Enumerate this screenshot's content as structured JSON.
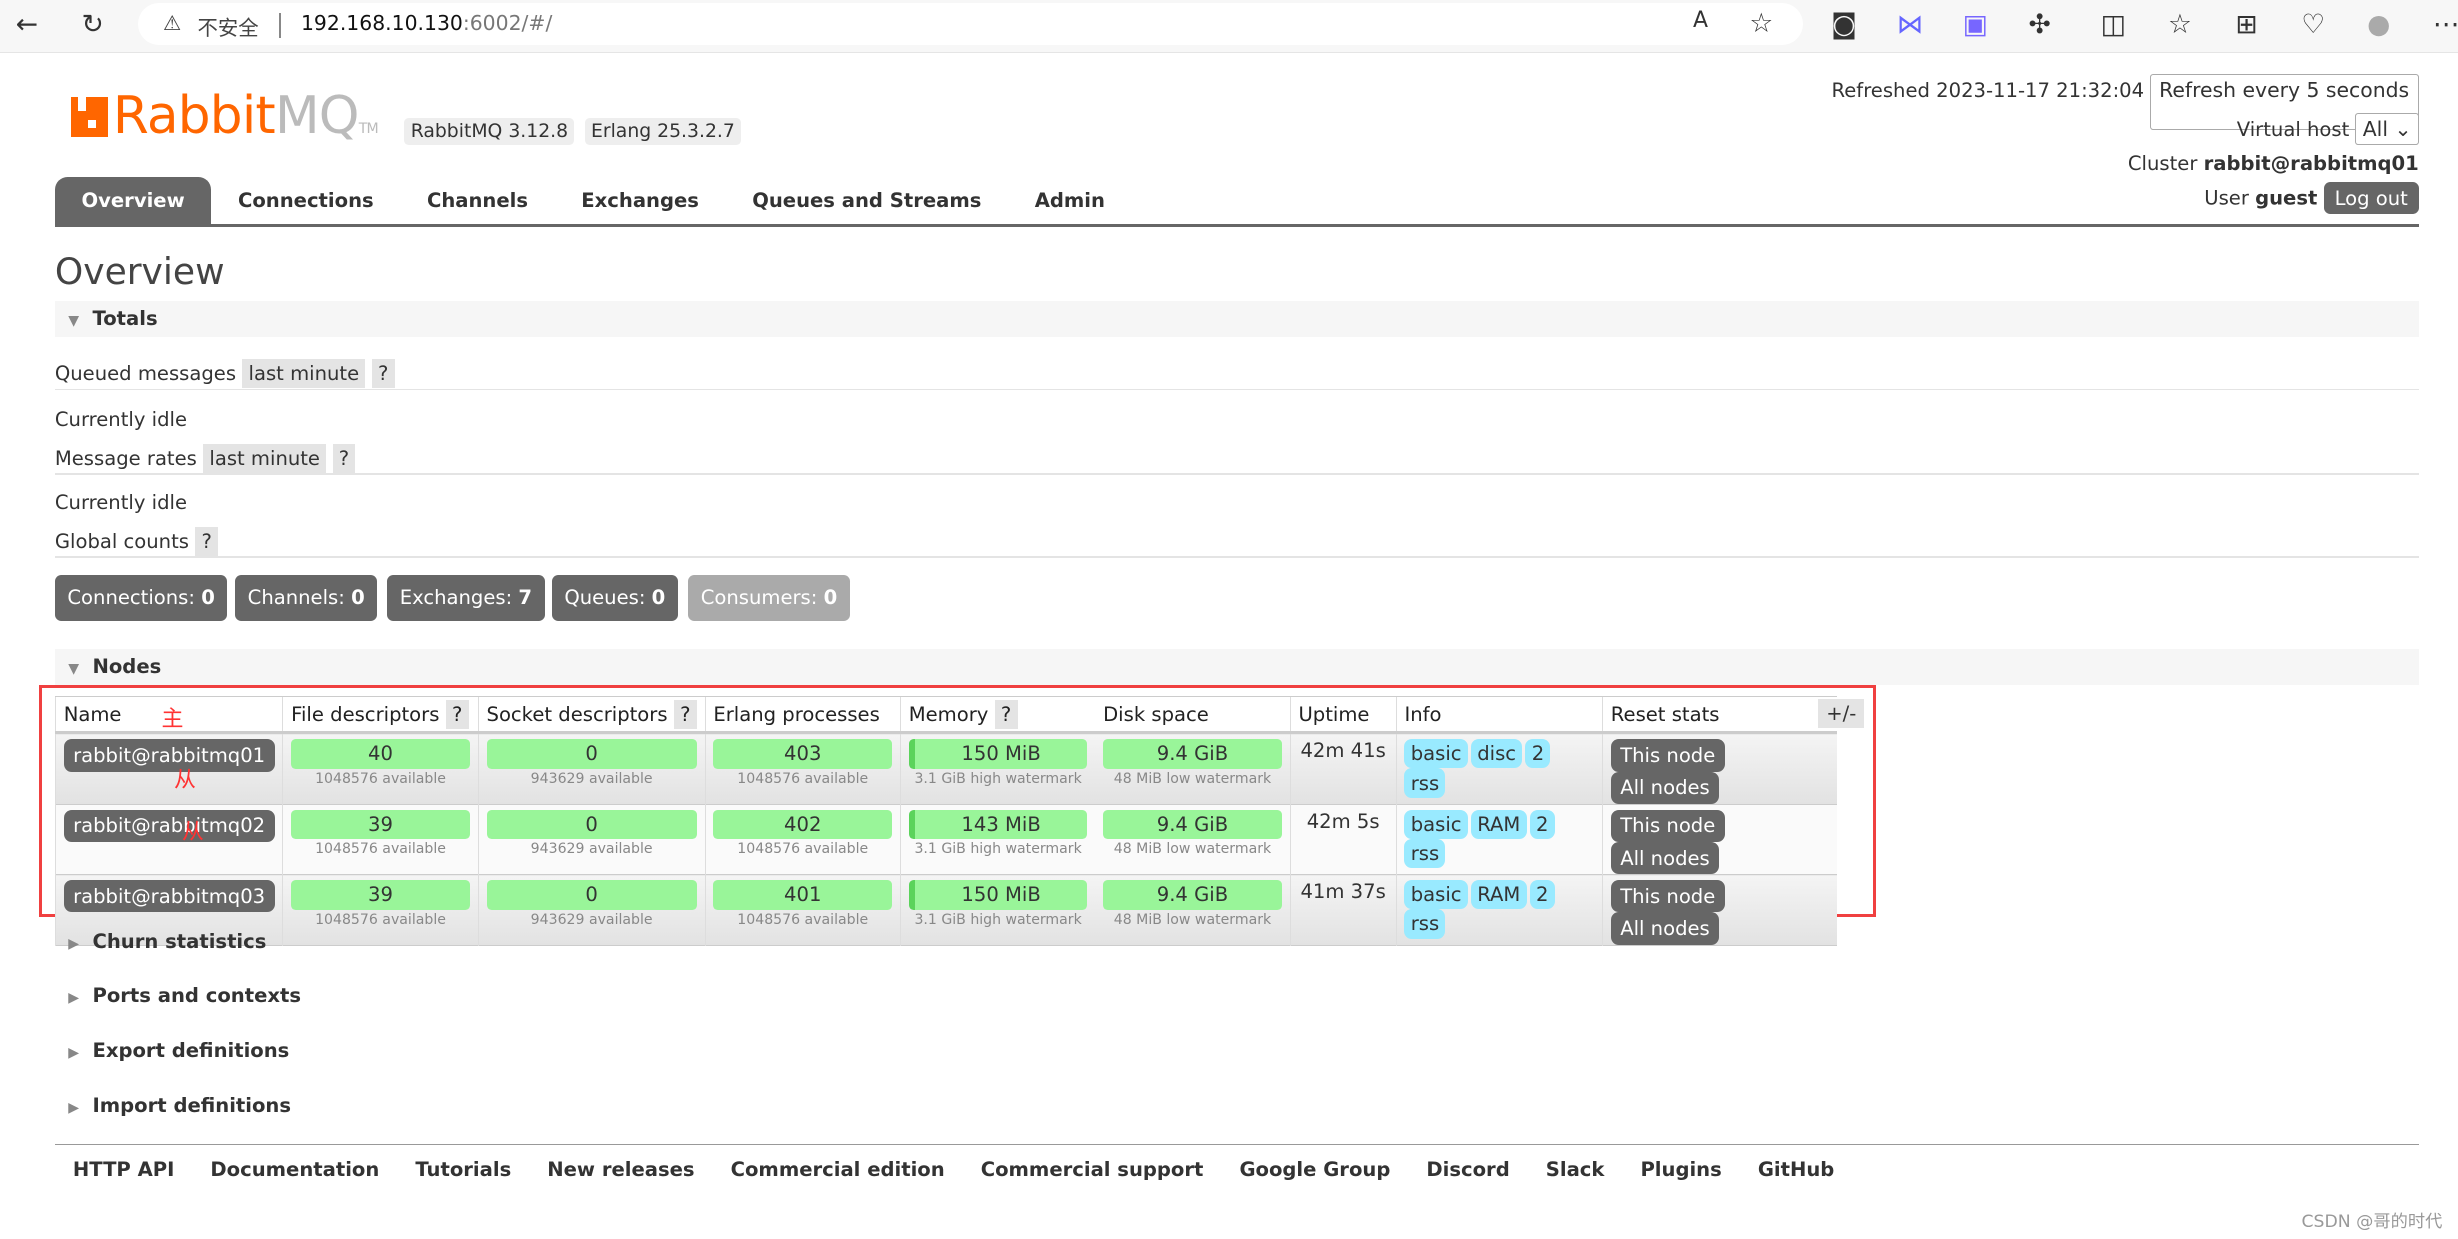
{
  "browser": {
    "insecure": "不安全",
    "url_host": "192.168.10.130",
    "url_rest": ":6002/#/"
  },
  "header": {
    "logo_main": "Rabbit",
    "logo_mq": "MQ",
    "logo_tm": "TM",
    "version": "RabbitMQ 3.12.8",
    "erlang": "Erlang 25.3.2.7",
    "refreshed": "Refreshed 2023-11-17 21:32:04",
    "refresh_select": "Refresh every 5 seconds",
    "vhost_label": "Virtual host",
    "vhost_select": "All",
    "cluster_label": "Cluster",
    "cluster": "rabbit@rabbitmq01",
    "user_label": "User",
    "user": "guest",
    "logout": "Log out"
  },
  "tabs": [
    "Overview",
    "Connections",
    "Channels",
    "Exchanges",
    "Queues and Streams",
    "Admin"
  ],
  "page_title": "Overview",
  "totals": {
    "title": "Totals",
    "queued": "Queued messages",
    "last_minute": "last minute",
    "help": "?",
    "idle": "Currently idle",
    "rates": "Message rates",
    "global": "Global counts",
    "counts": [
      {
        "label": "Connections:",
        "value": "0"
      },
      {
        "label": "Channels:",
        "value": "0"
      },
      {
        "label": "Exchanges:",
        "value": "7"
      },
      {
        "label": "Queues:",
        "value": "0"
      },
      {
        "label": "Consumers:",
        "value": "0"
      }
    ]
  },
  "nodes": {
    "title": "Nodes",
    "plusminus": "+/-",
    "columns": [
      "Name",
      "File descriptors",
      "Socket descriptors",
      "Erlang processes",
      "Memory",
      "Disk space",
      "Uptime",
      "Info",
      "Reset stats"
    ],
    "rows": [
      {
        "name": "rabbit@rabbitmq01",
        "fd": "40",
        "fd_sub": "1048576 available",
        "sd": "0",
        "sd_sub": "943629 available",
        "ep": "403",
        "ep_sub": "1048576 available",
        "mem": "150 MiB",
        "mem_sub": "3.1 GiB high watermark",
        "disk": "9.4 GiB",
        "disk_sub": "48 MiB low watermark",
        "uptime": "42m 41s",
        "info": [
          "basic",
          "disc",
          "2",
          "rss"
        ]
      },
      {
        "name": "rabbit@rabbitmq02",
        "fd": "39",
        "fd_sub": "1048576 available",
        "sd": "0",
        "sd_sub": "943629 available",
        "ep": "402",
        "ep_sub": "1048576 available",
        "mem": "143 MiB",
        "mem_sub": "3.1 GiB high watermark",
        "disk": "9.4 GiB",
        "disk_sub": "48 MiB low watermark",
        "uptime": "42m 5s",
        "info": [
          "basic",
          "RAM",
          "2",
          "rss"
        ]
      },
      {
        "name": "rabbit@rabbitmq03",
        "fd": "39",
        "fd_sub": "1048576 available",
        "sd": "0",
        "sd_sub": "943629 available",
        "ep": "401",
        "ep_sub": "1048576 available",
        "mem": "150 MiB",
        "mem_sub": "3.1 GiB high watermark",
        "disk": "9.4 GiB",
        "disk_sub": "48 MiB low watermark",
        "uptime": "41m 37s",
        "info": [
          "basic",
          "RAM",
          "2",
          "rss"
        ]
      }
    ],
    "this_node": "This node",
    "all_nodes": "All nodes",
    "annotations": [
      "主",
      "从",
      "从"
    ]
  },
  "sections": [
    "Churn statistics",
    "Ports and contexts",
    "Export definitions",
    "Import definitions"
  ],
  "footer": [
    "HTTP API",
    "Documentation",
    "Tutorials",
    "New releases",
    "Commercial edition",
    "Commercial support",
    "Google Group",
    "Discord",
    "Slack",
    "Plugins",
    "GitHub"
  ],
  "watermark": "CSDN @哥的时代"
}
